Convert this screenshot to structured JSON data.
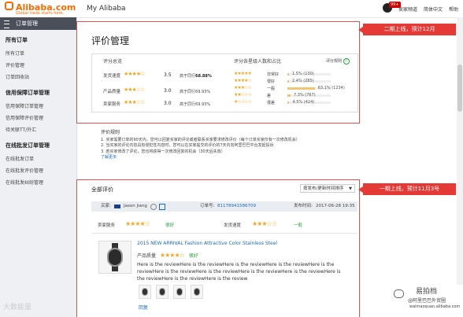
{
  "header": {
    "logo_text": "Alibaba.com",
    "logo_sub": "Global trade starts here.",
    "title": "My Alibaba",
    "badge": "99+",
    "links": [
      "卖家频道",
      "简体中文",
      "帮助"
    ]
  },
  "sidebar": {
    "head_label": "订单管理",
    "sections": [
      {
        "title": "所有订单",
        "items": [
          "所有订单",
          "评价管理",
          "订单回收站"
        ]
      },
      {
        "title": "信用保障订单管理",
        "items": [
          "信用保障订单管理",
          "信用保障评价管理",
          "待关联TT/外汇"
        ]
      },
      {
        "title": "在线批发订单管理",
        "items": [
          "在线批发订单",
          "在线批发评价管理",
          "在线批发纠纷管理"
        ]
      }
    ]
  },
  "summary": {
    "page_title": "评价管理",
    "overview_title": "评分总览",
    "dist_title": "评分各星级人数和占比",
    "rules_link": "评分规则",
    "rows": [
      {
        "label": "发货速度",
        "stars": "★★★★☆",
        "score": "3.5",
        "higher_prefix": "高于同行",
        "higher_value": "68.88%"
      },
      {
        "label": "产品质量",
        "stars": "★★★☆☆",
        "score": "3.0",
        "higher_prefix": "高于同行",
        "higher_value": "69.93%"
      },
      {
        "label": "卖家服务",
        "stars": "★★★☆☆",
        "score": "3.0",
        "higher_prefix": "高于同行",
        "higher_value": "69.93%"
      }
    ],
    "distribution": [
      {
        "stars": "★★★★★",
        "label": "非常好",
        "pct": "1.5%",
        "count": "(130)",
        "fraction": 0.015
      },
      {
        "stars": "★★★★☆",
        "label": "很好",
        "pct": "2.4%",
        "count": "(285)",
        "fraction": 0.024
      },
      {
        "stars": "★★★☆☆",
        "label": "一般",
        "pct": "63.1%",
        "count": "(1234)",
        "fraction": 0.631
      },
      {
        "stars": "★★☆☆☆",
        "label": "差",
        "pct": "7.3%",
        "count": "(767)",
        "fraction": 0.073
      },
      {
        "stars": "★☆☆☆☆",
        "label": "很差",
        "pct": "4.5%",
        "count": "(424)",
        "fraction": 0.045
      }
    ]
  },
  "rules": {
    "title": "评价规则",
    "lines": [
      "1. 买家需要订单的90天内，您可以回复买家的评论或者联系买家要求修改评价（每个订单买家仅有一次修改机会）",
      "2. 当买家的评论内容具有侵犯性内容时，您可以在买家提交的评价的7天内向阿里巴巴平台发起投诉",
      "3. 若买家修改了评论，您也将获得一次修改回复的机会（30天后失效）"
    ],
    "more": "了解更多"
  },
  "callouts": {
    "phase2": "二期上线，预计12月",
    "phase1": "一期上线，预计11月3号"
  },
  "reviews": {
    "title": "全部评价",
    "sort": "按发布/更新时间排序",
    "buyer_label": "买家:",
    "buyer_name": "Jason jiang",
    "order_label": "订单号:",
    "order_no": "81178941586709",
    "time_label": "发布时间:",
    "time": "2017-06-28 19:35",
    "seller_service_label": "卖家服务",
    "seller_service_stars": "★★★★☆",
    "seller_service_text": "很好",
    "ship_label": "发货速度",
    "ship_stars": "★★★☆☆",
    "ship_text": "一般",
    "product_title": "2015 NEW ARRIVAL Fashion Attractive Color Stainless Steel",
    "quality_label": "产品质量",
    "quality_stars": "★★★★☆",
    "quality_text": "很好",
    "text": "Here is the reviewHere is the reviewHere is the reviewHere is the reviewHere is the reviewHere is the reviewHere is the reviewHere is the reviewHere is the reviewHere is the reviewHere is the reviewHere is the review",
    "reply": "回复"
  },
  "watermarks": {
    "left": "大数能量",
    "right": "易拍档",
    "right_sub": "@阿里巴巴外贸圈",
    "right_url": "waimaoquan.alibaba.com"
  }
}
